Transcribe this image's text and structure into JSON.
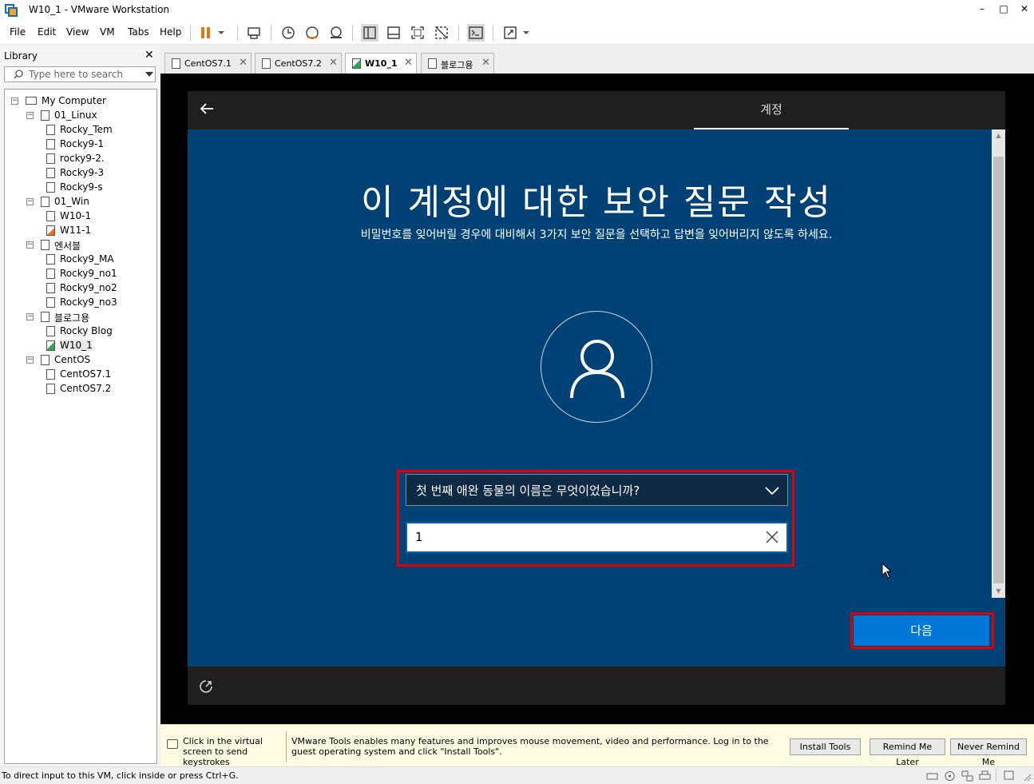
{
  "window": {
    "title": "W10_1 - VMware Workstation",
    "minimize": "–",
    "maximize": "□",
    "close": "✕"
  },
  "menu": [
    "File",
    "Edit",
    "View",
    "VM",
    "Tabs",
    "Help"
  ],
  "library": {
    "title": "Library",
    "close": "✕",
    "search_placeholder": "Type here to search",
    "tree": [
      {
        "label": "My Computer",
        "level": 0,
        "type": "computer"
      },
      {
        "label": "01_Linux",
        "level": 1,
        "type": "folder"
      },
      {
        "label": "Rocky_Tem",
        "level": 2,
        "type": "vm"
      },
      {
        "label": "Rocky9-1",
        "level": 2,
        "type": "vm"
      },
      {
        "label": "rocky9-2.",
        "level": 2,
        "type": "vm"
      },
      {
        "label": "Rocky9-3",
        "level": 2,
        "type": "vm"
      },
      {
        "label": "Rocky9-s",
        "level": 2,
        "type": "vm"
      },
      {
        "label": "01_Win",
        "level": 1,
        "type": "folder"
      },
      {
        "label": "W10-1",
        "level": 2,
        "type": "vm"
      },
      {
        "label": "W11-1",
        "level": 2,
        "type": "vm-locked"
      },
      {
        "label": "엔서블",
        "level": 1,
        "type": "folder"
      },
      {
        "label": "Rocky9_MA",
        "level": 2,
        "type": "vm"
      },
      {
        "label": "Rocky9_no1",
        "level": 2,
        "type": "vm"
      },
      {
        "label": "Rocky9_no2",
        "level": 2,
        "type": "vm"
      },
      {
        "label": "Rocky9_no3",
        "level": 2,
        "type": "vm"
      },
      {
        "label": "블로그용",
        "level": 1,
        "type": "folder"
      },
      {
        "label": "Rocky Blog",
        "level": 2,
        "type": "vm"
      },
      {
        "label": "W10_1",
        "level": 2,
        "type": "vm-running",
        "selected": true
      },
      {
        "label": "CentOS",
        "level": 1,
        "type": "folder"
      },
      {
        "label": "CentOS7.1",
        "level": 2,
        "type": "vm"
      },
      {
        "label": "CentOS7.2",
        "level": 2,
        "type": "vm"
      }
    ]
  },
  "tabs": [
    {
      "label": "CentOS7.1",
      "active": false
    },
    {
      "label": "CentOS7.2",
      "active": false
    },
    {
      "label": "W10_1",
      "active": true
    },
    {
      "label": "블로그용",
      "active": false
    }
  ],
  "guest": {
    "step_label": "계정",
    "heading": "이 계정에 대한 보안 질문 작성",
    "subtitle": "비밀번호를 잊어버릴 경우에 대비해서 3가지 보안 질문을 선택하고 답변을 잊어버리지 않도록 하세요.",
    "question_selected": "첫 번째 애완 동물의 이름은 무엇이었습니까?",
    "answer_value": "1",
    "next_label": "다음"
  },
  "notification": {
    "hint": "Click in the virtual screen to send keystrokes",
    "message": "VMware Tools enables many features and improves mouse movement, video and performance. Log in to the guest operating system and click \"Install Tools\".",
    "install_label": "Install Tools",
    "remind_label": "Remind Me Later",
    "never_label": "Never Remind Me"
  },
  "status": {
    "text": "To direct input to this VM, click inside or press Ctrl+G."
  },
  "colors": {
    "oobe_bg": "#004275",
    "next_button": "#0078d7",
    "highlight": "#e00000",
    "pause_icon": "#e8730f"
  }
}
